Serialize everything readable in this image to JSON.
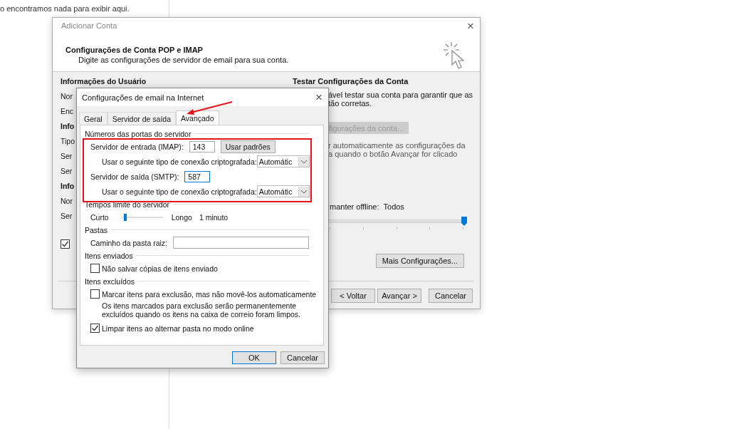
{
  "background_page": {
    "message": "o encontramos nada para exibir aqui."
  },
  "account_dialog": {
    "title": "Adicionar Conta",
    "close_glyph": "×",
    "heading": "Configurações de Conta POP e IMAP",
    "subheading": "Digite as configurações de servidor de email para sua conta.",
    "left_items": [
      {
        "kind": "heading",
        "text": "Informações do Usuário"
      },
      {
        "kind": "label",
        "text": "Nor"
      },
      {
        "kind": "label",
        "text": "Enc"
      },
      {
        "kind": "heading",
        "text": "Info"
      },
      {
        "kind": "label",
        "text": "Tipo"
      },
      {
        "kind": "label",
        "text": "Ser"
      },
      {
        "kind": "label",
        "text": "Ser"
      },
      {
        "kind": "heading",
        "text": "Info"
      },
      {
        "kind": "label",
        "text": "Nor"
      },
      {
        "kind": "label",
        "text": "Ser"
      }
    ],
    "left_checkbox": {
      "checked": true
    },
    "test_title": "Testar Configurações da Conta",
    "test_description": [
      "ável testar sua conta para garantir que as",
      "tão corretas."
    ],
    "test_button": {
      "label": "figurações da conta...",
      "disabled": true
    },
    "auto_test_lines": [
      "r automaticamente as configurações da",
      "a quando o botão Avançar for clicado"
    ],
    "offline_label": "manter offline:",
    "offline_value": "Todos",
    "offline_slider": {
      "level": 1
    },
    "more_button": "Mais Configurações...",
    "buttons": [
      {
        "label": "< Voltar"
      },
      {
        "label": "Avançar >"
      },
      {
        "label": "Cancelar"
      }
    ]
  },
  "settings_dialog": {
    "title": "Configurações de email na Internet",
    "close_glyph": "×",
    "tabs": [
      {
        "label": "Geral",
        "selected": false
      },
      {
        "label": "Servidor de saída",
        "selected": false
      },
      {
        "label": "Avançado",
        "selected": true
      }
    ],
    "groups": [
      {
        "title": "Números das portas do servidor",
        "rows": [
          {
            "kind": "port",
            "label": "Servidor de entrada (IMAP):",
            "value": "143",
            "focused": false,
            "button": "Usar padrões"
          },
          {
            "kind": "select",
            "label": "Usar o seguinte tipo de conexão criptografada:",
            "value": "Automátic"
          },
          {
            "kind": "port",
            "label": "Servidor de saída (SMTP):",
            "value": "587",
            "focused": true
          },
          {
            "kind": "select",
            "label": "Usar o seguinte tipo de conexão criptografada:",
            "value": "Automátic"
          }
        ]
      },
      {
        "title": "Tempos limite do servidor",
        "rows": [
          {
            "kind": "slider",
            "min_label": "Curto",
            "max_label": "Longo",
            "level": 0.1,
            "reading": "1 minuto"
          }
        ]
      },
      {
        "title": "Pastas",
        "rows": [
          {
            "kind": "text",
            "label": "Caminho da pasta raiz:"
          }
        ]
      },
      {
        "title": "Itens enviados",
        "rows": [
          {
            "kind": "checkbox",
            "label": "Não salvar cópias de itens enviado",
            "checked": false
          }
        ]
      },
      {
        "title": "Itens excluídos",
        "rows": [
          {
            "kind": "checkbox",
            "label": "Marcar itens para exclusão, mas não movê-los automaticamente",
            "checked": false
          },
          {
            "kind": "note",
            "text": "Os itens marcados para exclusão serão permanentemente excluídos quando os itens na caixa de correio foram limpos."
          },
          {
            "kind": "checkbox",
            "label": "Limpar itens ao alternar pasta no modo online",
            "checked": true
          }
        ]
      }
    ],
    "buttons": [
      {
        "label": "OK",
        "default": true
      },
      {
        "label": "Cancelar",
        "default": false
      }
    ]
  }
}
